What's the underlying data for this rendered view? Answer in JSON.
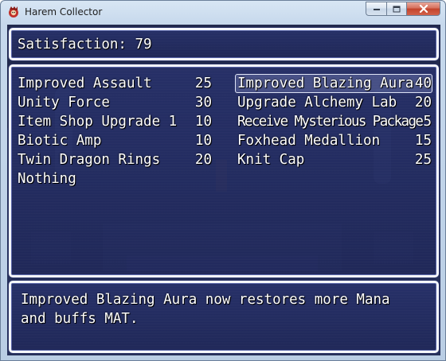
{
  "window": {
    "title": "Harem Collector",
    "icon": "app-icon",
    "controls": [
      "minimize-icon",
      "maximize-icon",
      "close-icon"
    ]
  },
  "status": {
    "text": "Satisfaction: 79"
  },
  "upgrades": {
    "left": [
      {
        "name": "Improved Assault",
        "cost": "25"
      },
      {
        "name": "Unity Force",
        "cost": "30"
      },
      {
        "name": "Item Shop Upgrade 1",
        "cost": "10"
      },
      {
        "name": "Biotic Amp",
        "cost": "10"
      },
      {
        "name": "Twin Dragon Rings",
        "cost": "20"
      },
      {
        "name": "Nothing",
        "cost": ""
      }
    ],
    "right": [
      {
        "name": "Improved Blazing Aura",
        "cost": "40",
        "selected": true
      },
      {
        "name": "Upgrade Alchemy Lab",
        "cost": "20"
      },
      {
        "name": "Receive Mysterious Package",
        "cost": "5"
      },
      {
        "name": "Foxhead Medallion",
        "cost": "15"
      },
      {
        "name": "Knit Cap",
        "cost": "25"
      }
    ]
  },
  "help": {
    "line1": "Improved Blazing Aura now restores more Mana",
    "line2": "and buffs MAT."
  },
  "colors": {
    "window_fill": "#242e68",
    "window_border": "#f4f6fb",
    "text": "#ffffff"
  }
}
